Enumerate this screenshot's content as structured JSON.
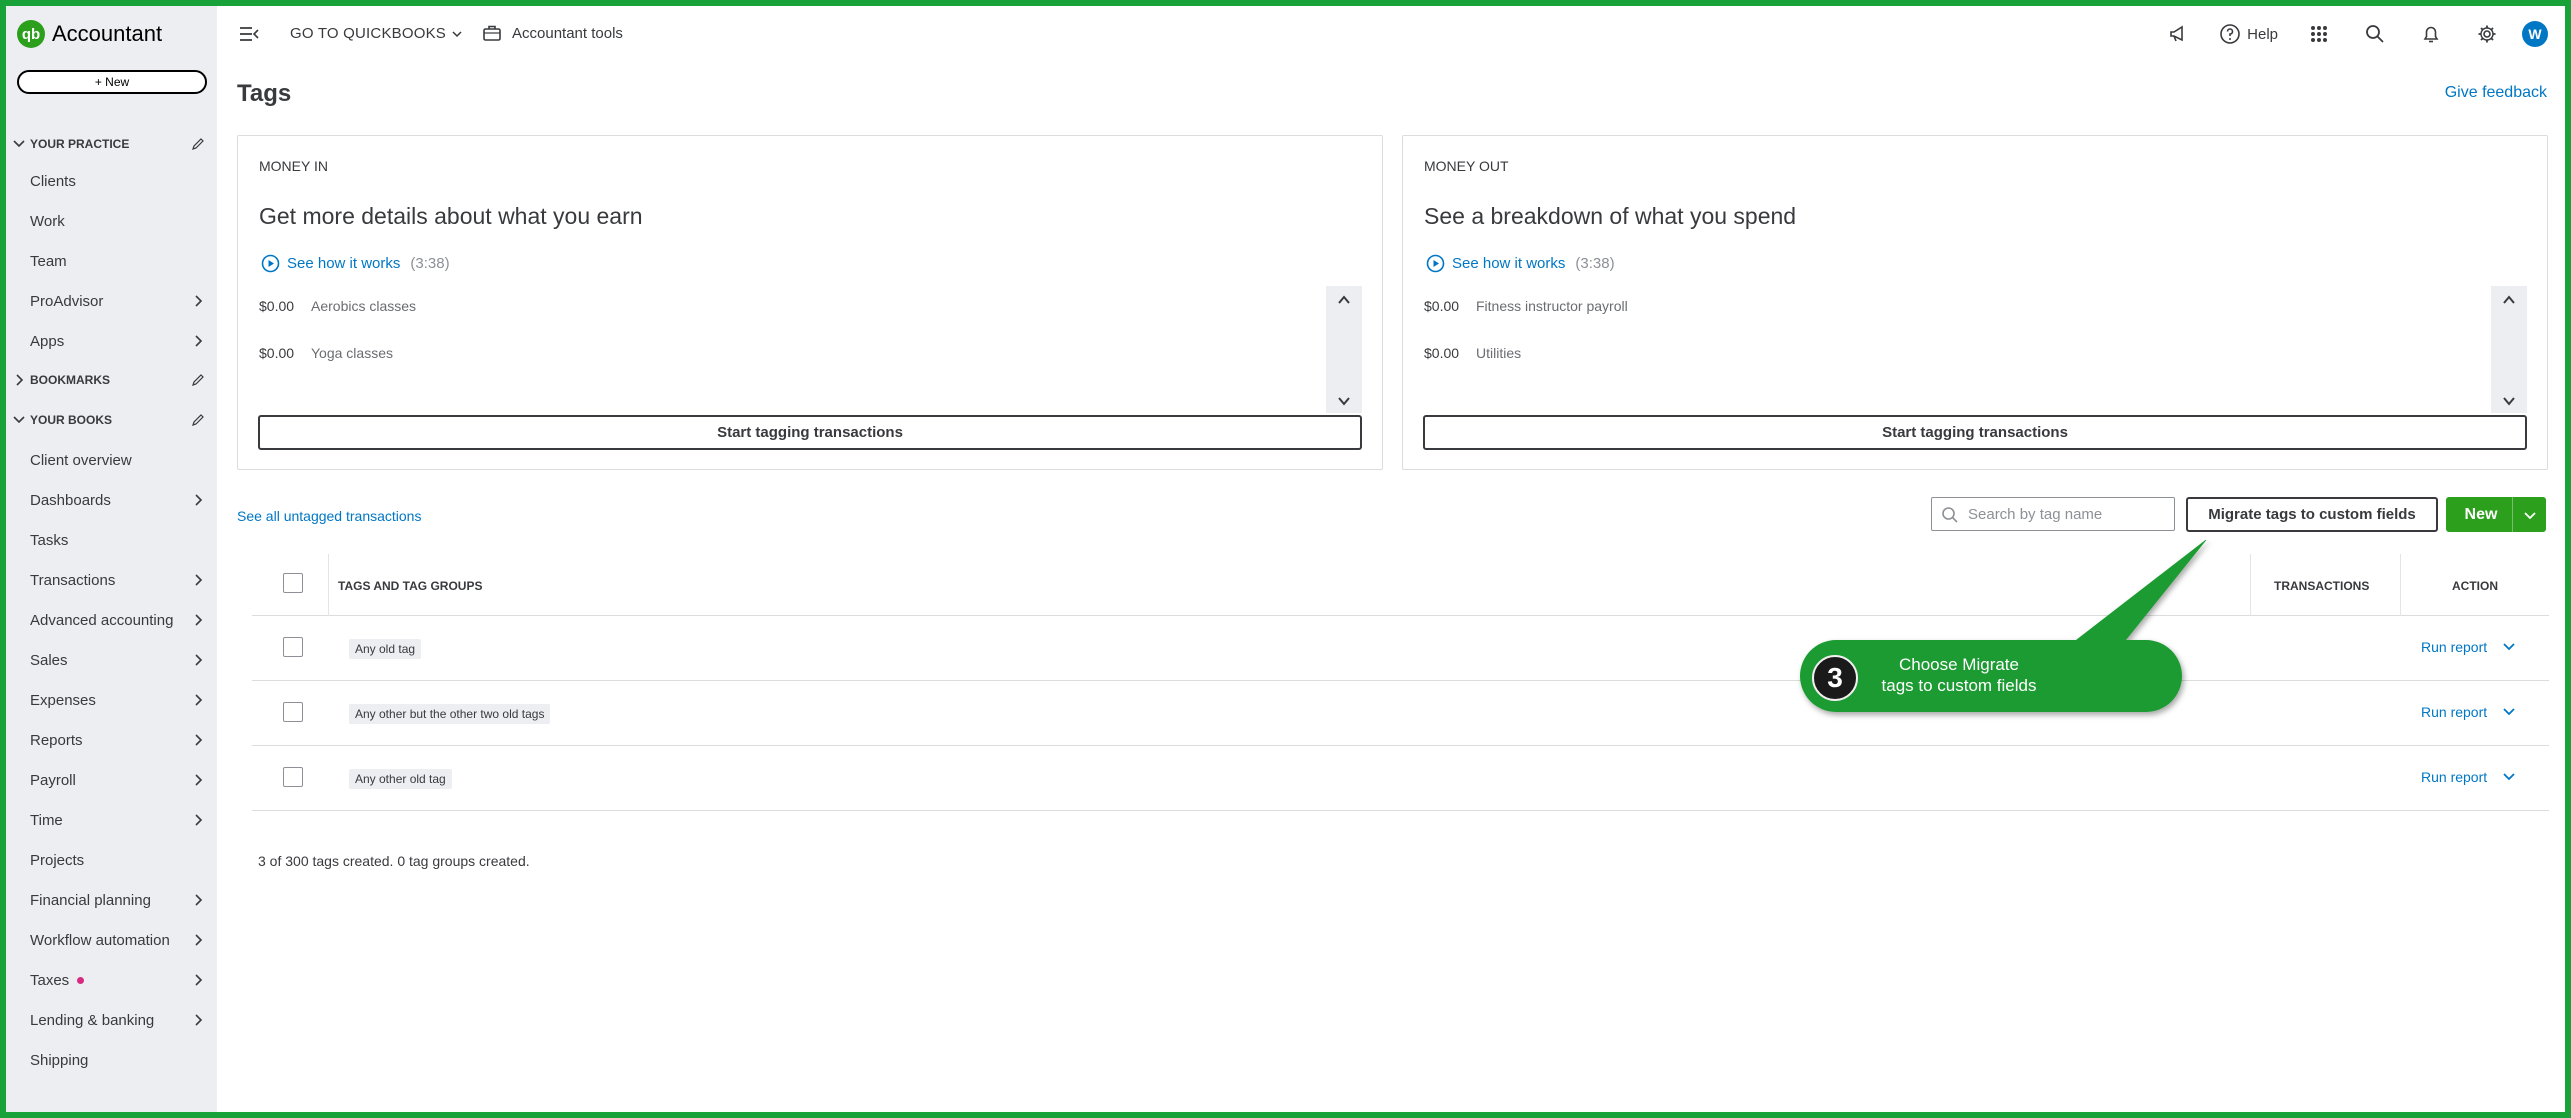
{
  "app": {
    "logo_mark": "qb",
    "name": "Accountant"
  },
  "sidebar": {
    "new_label": "+ New",
    "sections": {
      "practice": "YOUR PRACTICE",
      "bookmarks": "BOOKMARKS",
      "books": "YOUR BOOKS"
    },
    "items": {
      "clients": "Clients",
      "work": "Work",
      "team": "Team",
      "proadvisor": "ProAdvisor",
      "apps": "Apps",
      "client_overview": "Client overview",
      "dashboards": "Dashboards",
      "tasks": "Tasks",
      "transactions": "Transactions",
      "advanced_accounting": "Advanced accounting",
      "sales": "Sales",
      "expenses": "Expenses",
      "reports": "Reports",
      "payroll": "Payroll",
      "time": "Time",
      "projects": "Projects",
      "financial_planning": "Financial planning",
      "workflow_automation": "Workflow automation",
      "taxes": "Taxes",
      "lending_banking": "Lending & banking",
      "shipping": "Shipping"
    },
    "notification_color": "#d52b80"
  },
  "topbar": {
    "goto_label": "GO TO QUICKBOOKS",
    "tools_label": "Accountant tools",
    "help_label": "Help",
    "avatar_initial": "W",
    "icons": [
      "hamburger-collapse-icon",
      "briefcase-icon",
      "megaphone-icon",
      "help-icon",
      "apps-grid-icon",
      "search-icon",
      "bell-icon",
      "gear-icon"
    ]
  },
  "page": {
    "title": "Tags",
    "feedback_link": "Give feedback"
  },
  "cards": {
    "money_in": {
      "eyebrow": "MONEY IN",
      "heading": "Get more details about what you earn",
      "video_link": "See how it works",
      "video_duration": "(3:38)",
      "rows": [
        {
          "amount": "$0.00",
          "name": "Aerobics classes"
        },
        {
          "amount": "$0.00",
          "name": "Yoga classes"
        }
      ],
      "button": "Start tagging transactions"
    },
    "money_out": {
      "eyebrow": "MONEY OUT",
      "heading": "See a breakdown of what you spend",
      "video_link": "See how it works",
      "video_duration": "(3:38)",
      "rows": [
        {
          "amount": "$0.00",
          "name": "Fitness instructor payroll"
        },
        {
          "amount": "$0.00",
          "name": "Utilities"
        }
      ],
      "button": "Start tagging transactions"
    }
  },
  "toolbar": {
    "untagged_link": "See all untagged transactions",
    "search_placeholder": "Search by tag name",
    "migrate_button": "Migrate tags to custom fields",
    "new_button": "New"
  },
  "table": {
    "headers": {
      "tags": "TAGS AND TAG GROUPS",
      "transactions": "TRANSACTIONS",
      "action": "ACTION"
    },
    "rows": [
      {
        "tag": "Any old tag",
        "transactions": "",
        "action": "Run report"
      },
      {
        "tag": "Any other but the other two old tags",
        "transactions": "",
        "action": "Run report"
      },
      {
        "tag": "Any other old tag",
        "transactions": "",
        "action": "Run report"
      }
    ],
    "summary": "3 of 300 tags created. 0 tag groups created."
  },
  "callout": {
    "step": "3",
    "line1": "Choose Migrate",
    "line2": "tags to custom fields",
    "color": "#1e9b32"
  },
  "colors": {
    "brand_green": "#2ca01c",
    "link_blue": "#0077c5",
    "frame_green": "#19a13a"
  }
}
